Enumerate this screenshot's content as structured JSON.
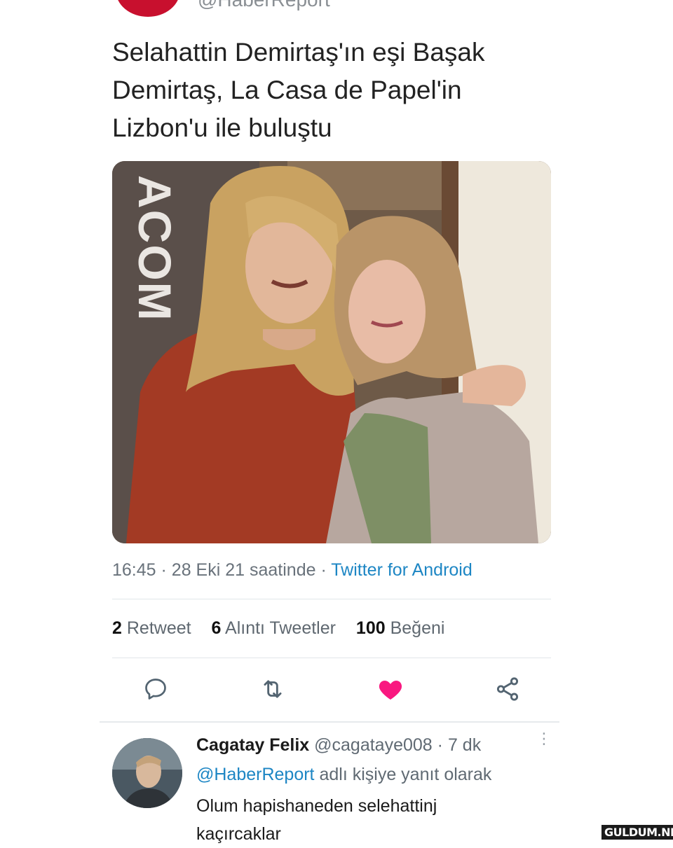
{
  "tweet": {
    "handle": "@HaberReport",
    "text": "Selahattin Demirtaş'ın eşi Başak Demirtaş, La Casa de Papel'in Lizbon'u ile buluştu",
    "time": "16:45",
    "date": "28 Eki 21 saatinde",
    "client": "Twitter for Android",
    "separator": "·",
    "photo_backdrop_text": "ACOM"
  },
  "stats": {
    "retweets": {
      "count": "2",
      "label": "Retweet"
    },
    "quotes": {
      "count": "6",
      "label": "Alıntı Tweetler"
    },
    "likes": {
      "count": "100",
      "label": "Beğeni"
    }
  },
  "actions": {
    "reply_icon": "reply-icon",
    "retweet_icon": "retweet-icon",
    "like_icon": "heart-filled-icon",
    "share_icon": "share-icon",
    "like_color": "#f91880",
    "icon_color": "#536471"
  },
  "reply": {
    "name": "Cagatay Felix",
    "handle": "@cagataye008",
    "age": "7 dk",
    "replying_mention": "@HaberReport",
    "replying_suffix": "adlı kişiye yanıt olarak",
    "text": "Olum hapishaneden selehattinj kaçırcaklar",
    "more_icon": "more-vertical-icon"
  },
  "watermark": "GULDUM.NET",
  "colors": {
    "link": "#1d86c4",
    "muted": "#69727b",
    "avatar_brand": "#c8102e"
  }
}
